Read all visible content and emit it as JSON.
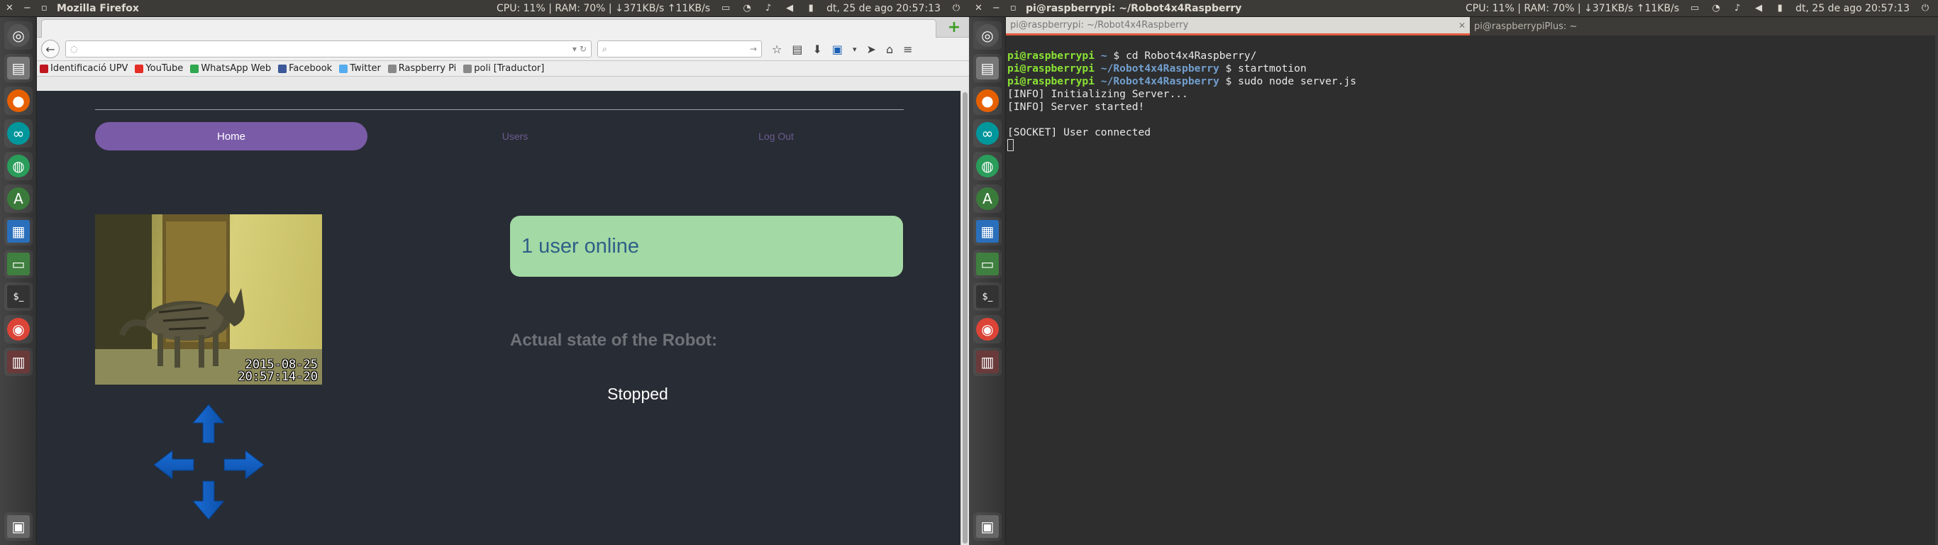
{
  "left_screen": {
    "topbar": {
      "title": "Mozilla Firefox",
      "status": "CPU: 11% | RAM: 70% | ↓371KB/s ↑11KB/s",
      "clock": "dt, 25 de ago 20:57:13"
    },
    "firefox": {
      "bookmarks": [
        {
          "label": "Identificació UPV",
          "icon": "upv-icon",
          "color": "#c0161f"
        },
        {
          "label": "YouTube",
          "icon": "youtube-icon",
          "color": "#e52d27"
        },
        {
          "label": "WhatsApp Web",
          "icon": "whatsapp-icon",
          "color": "#2fa84f"
        },
        {
          "label": "Facebook",
          "icon": "facebook-icon",
          "color": "#3b5998"
        },
        {
          "label": "Twitter",
          "icon": "twitter-icon",
          "color": "#55acee"
        },
        {
          "label": "Raspberry Pi",
          "icon": "page-icon",
          "color": "#888888"
        },
        {
          "label": "poli [Traductor]",
          "icon": "page-icon",
          "color": "#888888"
        }
      ],
      "page": {
        "nav": {
          "home": "Home",
          "users": "Users",
          "logout": "Log Out"
        },
        "camera_stamp_date": "2015-08-25",
        "camera_stamp_time": "20:57:14-20",
        "online_text": "1 user online",
        "state_title": "Actual state of the Robot:",
        "state_value": "Stopped"
      }
    }
  },
  "right_screen": {
    "topbar": {
      "title": "pi@raspberrypi: ~/Robot4x4Raspberry",
      "status": "CPU: 11% | RAM: 70% | ↓371KB/s ↑11KB/s",
      "clock": "dt, 25 de ago 20:57:13"
    },
    "terminal": {
      "tabs": [
        {
          "label": "pi@raspberrypi: ~/Robot4x4Raspberry"
        },
        {
          "label": "pi@raspberrypiPlus: ~"
        }
      ],
      "lines": [
        {
          "user": "pi@raspberrypi",
          "path": "~",
          "cmd": "cd Robot4x4Raspberry/"
        },
        {
          "user": "pi@raspberrypi",
          "path": "~/Robot4x4Raspberry",
          "cmd": "startmotion"
        },
        {
          "user": "pi@raspberrypi",
          "path": "~/Robot4x4Raspberry",
          "cmd": "sudo node server.js"
        }
      ],
      "output": [
        "[INFO] Initializing Server...",
        "[INFO] Server started!",
        "",
        "[SOCKET] User connected"
      ]
    }
  },
  "colors": {
    "accent_purple": "#7a5ba8",
    "online_green": "#a3d9a4",
    "page_bg": "#282c34",
    "arrow_blue": "#1f6fd6"
  }
}
